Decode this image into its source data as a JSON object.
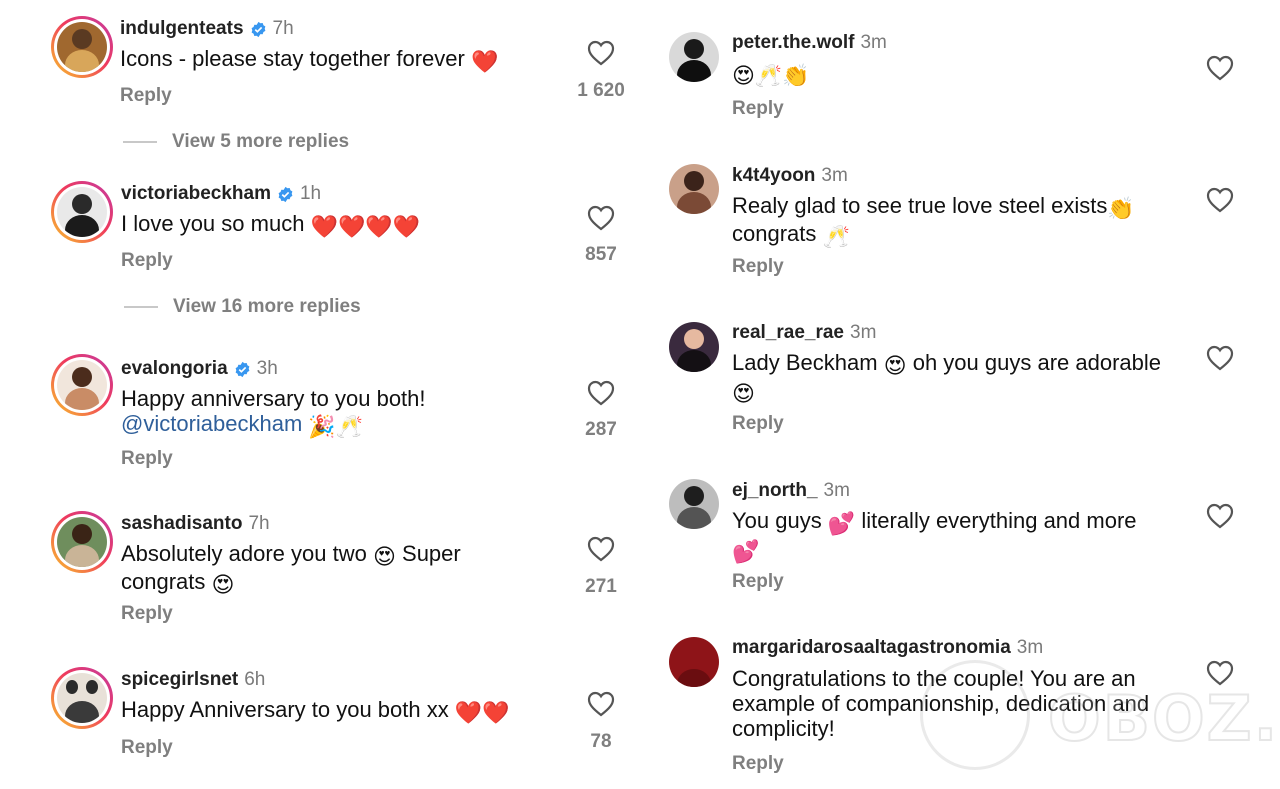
{
  "left_comments": [
    {
      "username": "indulgenteats",
      "verified": true,
      "time": "7h",
      "text": "Icons - please stay together forever",
      "emoji": "❤️",
      "reply": "Reply",
      "likes": "1 620",
      "view_replies": "View 5 more replies"
    },
    {
      "username": "victoriabeckham",
      "verified": true,
      "time": "1h",
      "text": "I love you so much",
      "emoji": "❤️❤️❤️❤️",
      "reply": "Reply",
      "likes": "857",
      "view_replies": "View 16 more replies"
    },
    {
      "username": "evalongoria",
      "verified": true,
      "time": "3h",
      "text": "Happy anniversary to you both!",
      "mention": "@victoriabeckham",
      "emoji": "🎉🥂",
      "reply": "Reply",
      "likes": "287"
    },
    {
      "username": "sashadisanto",
      "verified": false,
      "time": "7h",
      "text": "Absolutely adore you two",
      "emoji": "😍",
      "text2": "Super",
      "text3": "congrats",
      "emoji2": "😍",
      "reply": "Reply",
      "likes": "271"
    },
    {
      "username": "spicegirlsnet",
      "verified": false,
      "time": "6h",
      "text": "Happy Anniversary to you both xx",
      "emoji": "❤️❤️",
      "reply": "Reply",
      "likes": "78"
    }
  ],
  "right_comments": [
    {
      "username": "peter.the.wolf",
      "time": "3m",
      "emoji": "😍🥂👏",
      "reply": "Reply"
    },
    {
      "username": "k4t4yoon",
      "time": "3m",
      "text": "Realy glad to see true love steel exists",
      "emoji": "👏",
      "text2": "congrats",
      "emoji2": "🥂",
      "reply": "Reply"
    },
    {
      "username": "real_rae_rae",
      "time": "3m",
      "text": "Lady Beckham",
      "emoji": "😍",
      "text2": "oh you guys are adorable",
      "emoji2": "😍",
      "reply": "Reply"
    },
    {
      "username": "ej_north_",
      "time": "3m",
      "text": "You guys",
      "emoji": "💕",
      "text2": "literally everything and more",
      "emoji2": "💕",
      "reply": "Reply"
    },
    {
      "username": "margaridarosaaltagastronomia",
      "time": "3m",
      "text": "Congratulations to the couple! You are an example of companionship, dedication and complicity!",
      "reply": "Reply"
    }
  ],
  "watermark": {
    "text": "OBOZ.UA"
  },
  "colors": {
    "verified": "#3897f0",
    "mention": "#2f5f9a",
    "muted": "#7f7f7f"
  }
}
